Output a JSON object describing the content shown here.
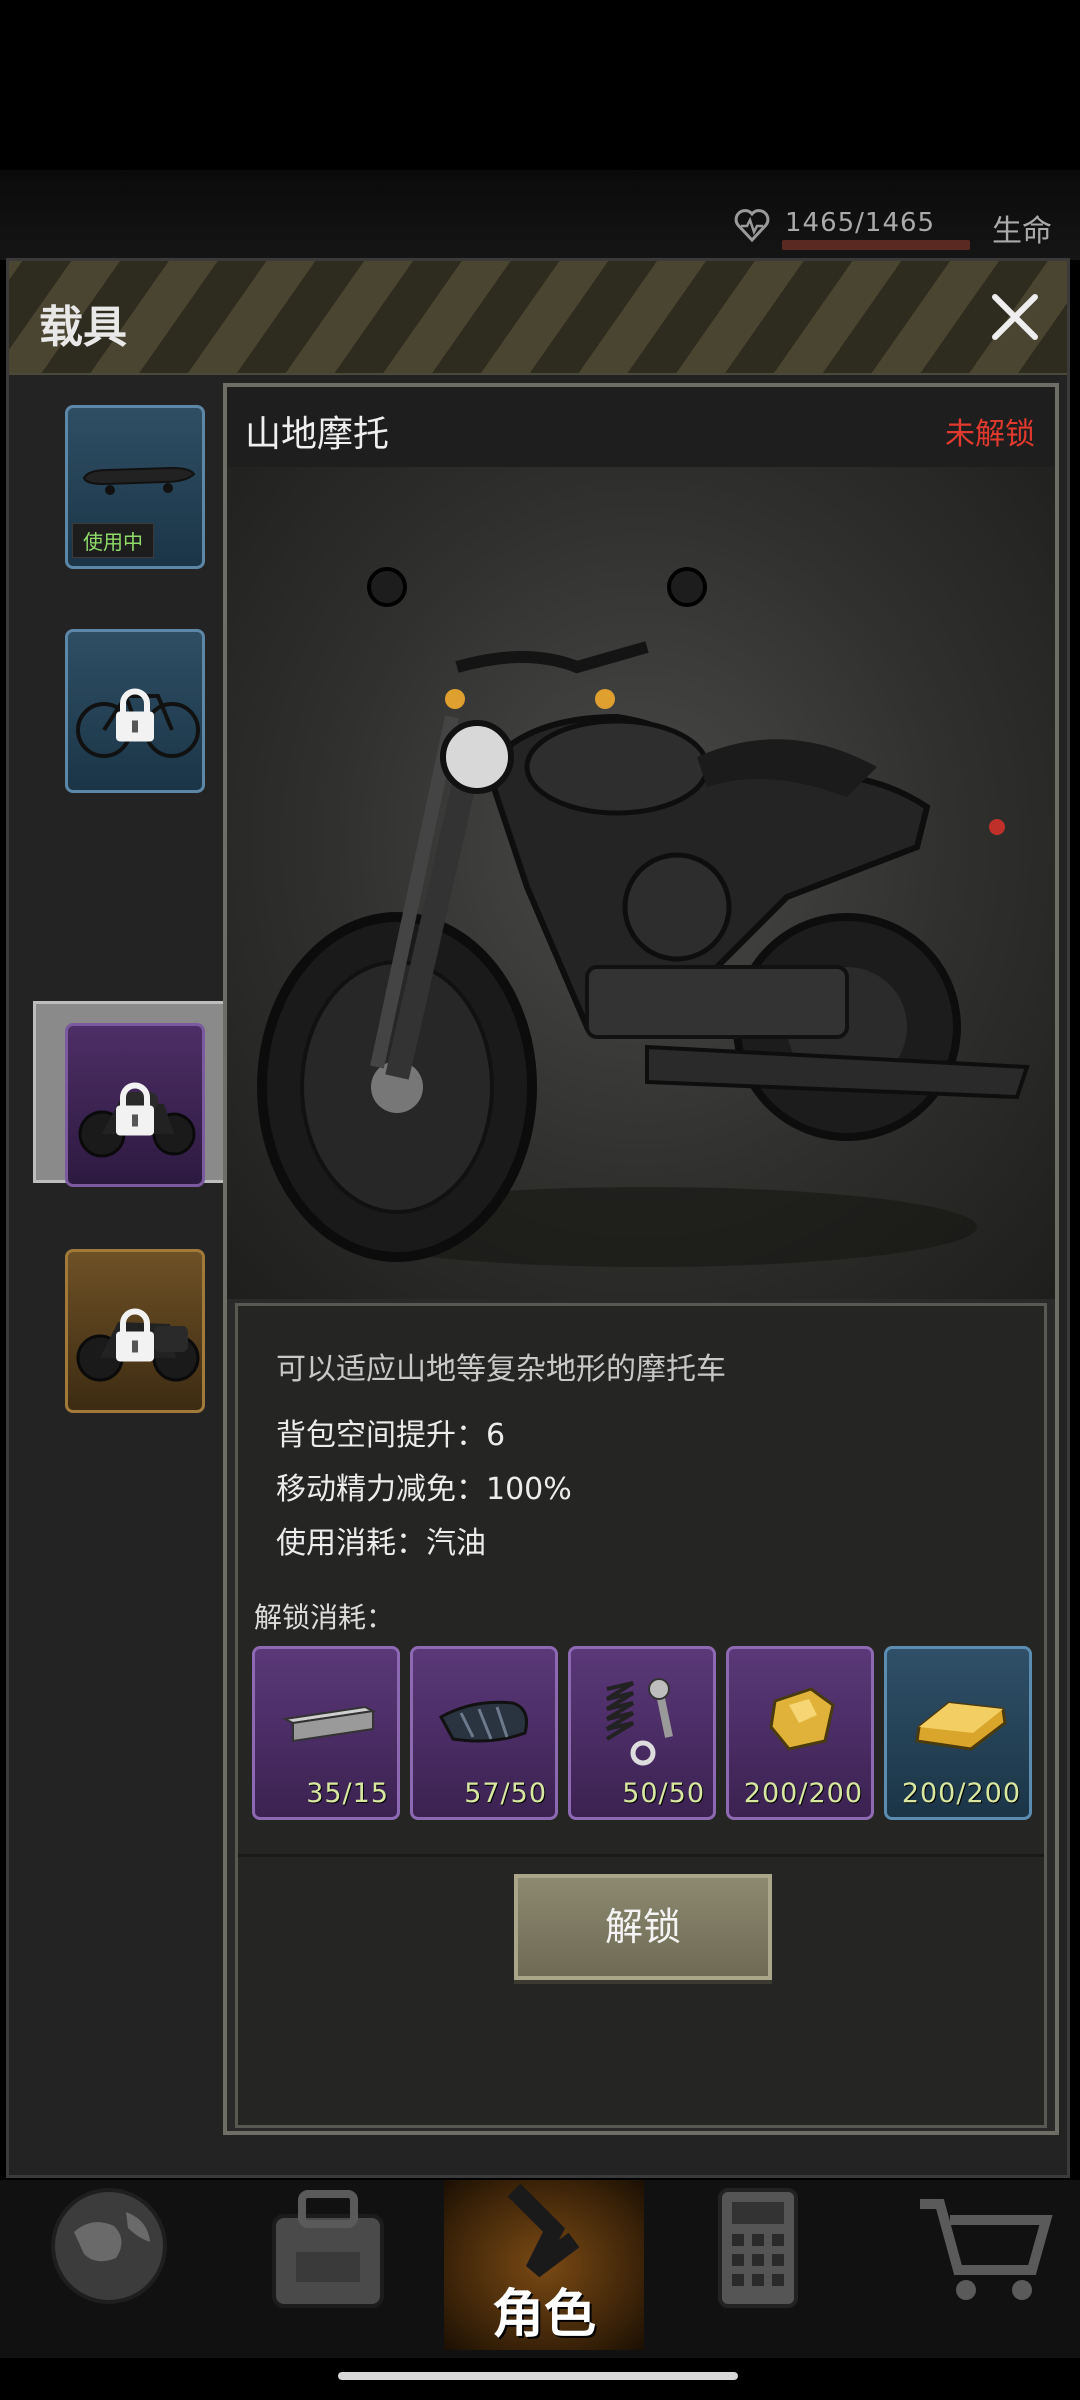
{
  "hud": {
    "hp": "1465/1465",
    "life_label": "生命"
  },
  "modal": {
    "title": "载具"
  },
  "sidebar": {
    "items": [
      {
        "name": "skateboard",
        "in_use_label": "使用中"
      },
      {
        "name": "bicycle",
        "locked": true
      },
      {
        "name": "mountain-motorcycle",
        "locked": true,
        "selected": true
      },
      {
        "name": "cruiser-motorcycle",
        "locked": true
      }
    ]
  },
  "detail": {
    "name": "山地摩托",
    "status": "未解锁",
    "description": "可以适应山地等复杂地形的摩托车",
    "stats": [
      "背包空间提升：6",
      "移动精力减免：100%",
      "使用消耗：汽油"
    ],
    "unlock_cost_label": "解锁消耗：",
    "resources": [
      {
        "icon": "steel-beam-icon",
        "count": "35/15"
      },
      {
        "icon": "rubber-sheet-icon",
        "count": "57/50"
      },
      {
        "icon": "spring-bolt-icon",
        "count": "50/50"
      },
      {
        "icon": "gold-nugget-icon",
        "count": "200/200"
      },
      {
        "icon": "gold-bar-icon",
        "count": "200/200"
      }
    ],
    "unlock_button": "解锁"
  },
  "nav": {
    "role_label": "角色"
  },
  "colors": {
    "locked_status": "#e03a2e",
    "resource_count": "#d8e8a0"
  }
}
